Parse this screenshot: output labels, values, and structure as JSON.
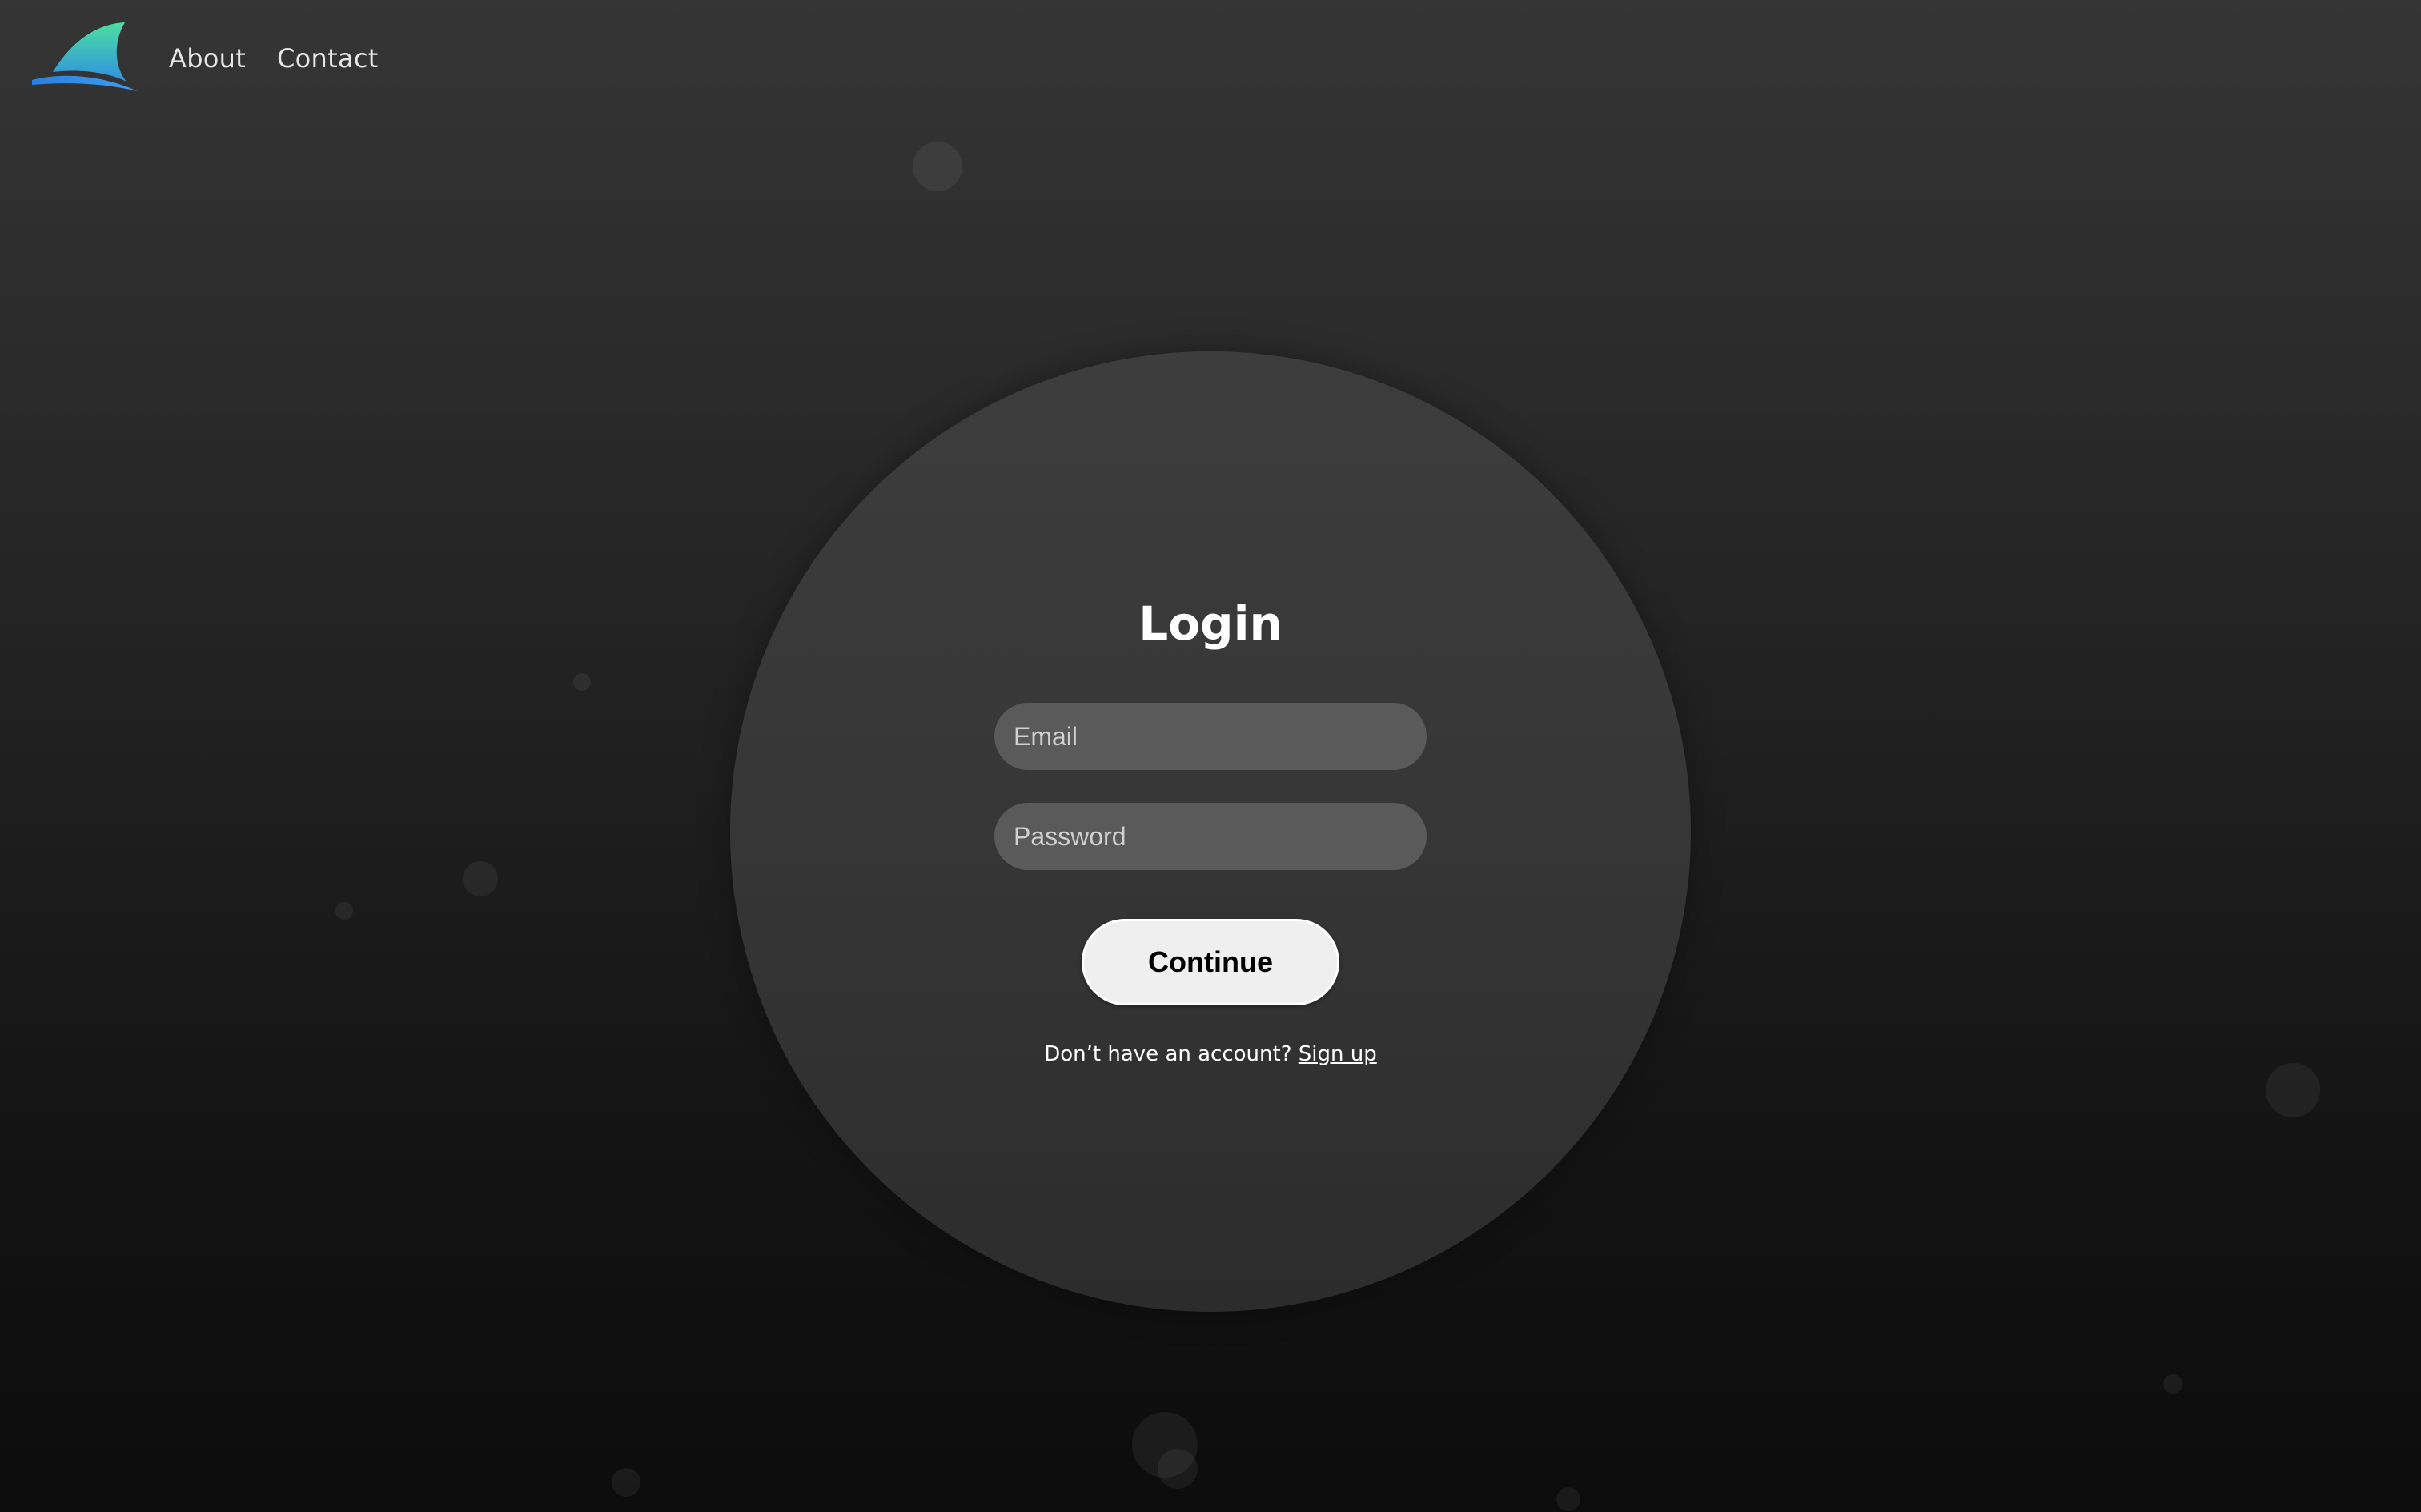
{
  "nav": {
    "logo_icon": "shark-fin-logo-icon",
    "items": [
      {
        "label": "About"
      },
      {
        "label": "Contact"
      }
    ]
  },
  "login": {
    "title": "Login",
    "email_placeholder": "Email",
    "password_placeholder": "Password",
    "email_value": "",
    "password_value": "",
    "continue_label": "Continue",
    "signup_prompt": "Don’t have an account?",
    "signup_link": "Sign up"
  },
  "colors": {
    "background_top": "#353535",
    "background_bottom": "#0c0c0c",
    "circle": "#3a3a3a",
    "field": "#5a5a5a",
    "button": "#efefef",
    "logo_gradient_start": "#4de0a0",
    "logo_gradient_end": "#2f7de0"
  }
}
